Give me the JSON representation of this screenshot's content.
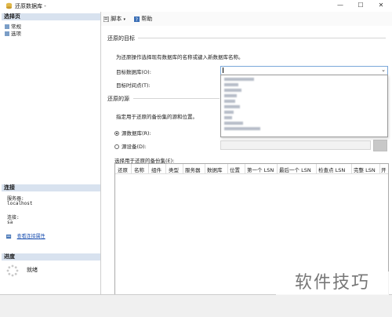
{
  "window": {
    "title": "还原数据库 -",
    "minimize": "—",
    "maximize": "☐",
    "close": "✕"
  },
  "left_pane": {
    "pages_header": "选择页",
    "pages": [
      {
        "label": "常规"
      },
      {
        "label": "选项"
      }
    ],
    "connection_header": "连接",
    "server_label": "服务器:",
    "server_value": "localhost",
    "connection_label": "连接:",
    "connection_value": "sa",
    "view_props_link": "查看连接属性",
    "progress_header": "进度",
    "progress_status": "就绪"
  },
  "toolbar": {
    "script_label": "脚本",
    "help_label": "帮助"
  },
  "restore_target": {
    "group_title": "还原的目标",
    "description": "为还原操作选择现有数据库的名称或键入新数据库名称。",
    "target_db_label": "目标数据库(O):",
    "target_db_value": "",
    "target_time_label": "目标时间点(T):"
  },
  "restore_source": {
    "group_title": "还原的源",
    "description": "指定用于还原的备份集的源和位置。",
    "source_db_label": "源数据库(R):",
    "source_device_label": "源设备(D):",
    "selected_option": "source_db"
  },
  "backup_sets": {
    "label": "选择用于还原的备份集(E):",
    "columns": [
      "还原",
      "名称",
      "组件",
      "类型",
      "服务器",
      "数据库",
      "位置",
      "第一个 LSN",
      "最后一个 LSN",
      "检查点 LSN",
      "完整 LSN",
      "开"
    ]
  },
  "watermark": "软件技巧",
  "colors": {
    "section_header_bg": "#d8e2ef",
    "link": "#1a4fb0",
    "combo_border": "#7aa7d9"
  }
}
